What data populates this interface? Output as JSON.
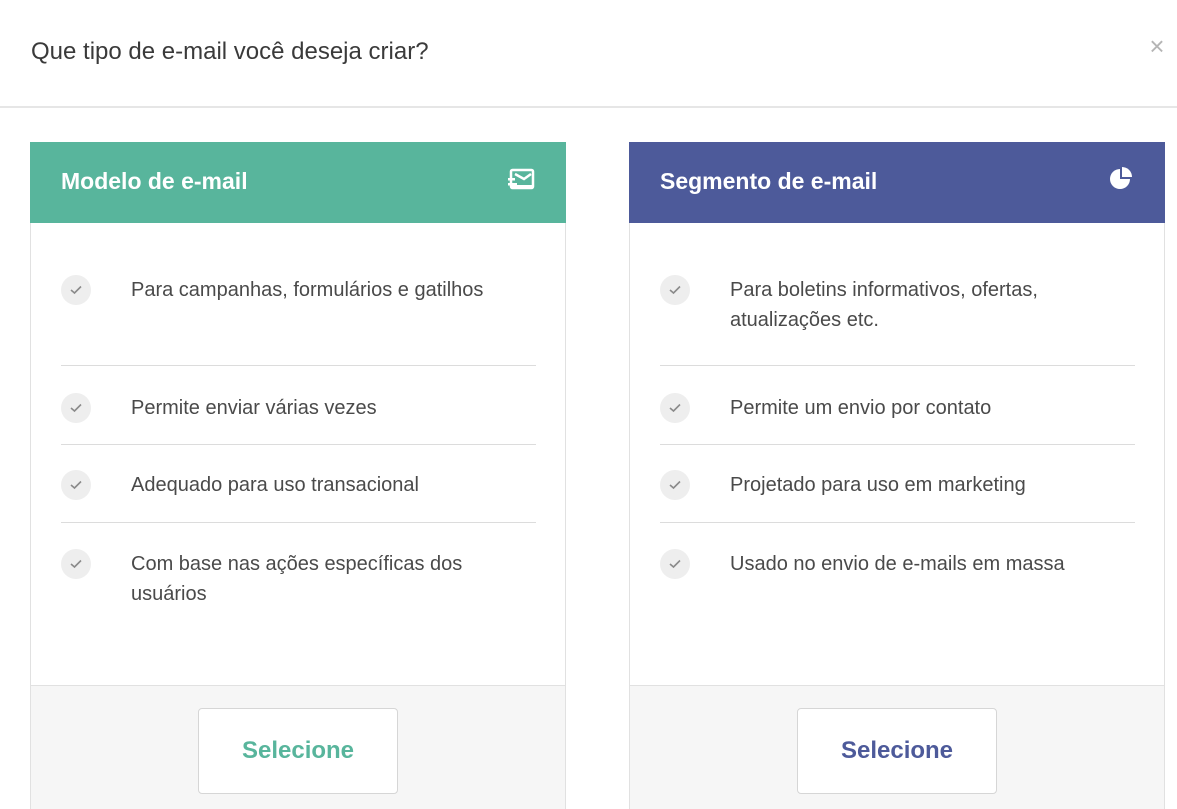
{
  "dialog": {
    "title": "Que tipo de e-mail você deseja criar?",
    "close_symbol": "×"
  },
  "cards": [
    {
      "title": "Modelo de e-mail",
      "icon": "mail-template-icon",
      "color": "#58b59c",
      "features": [
        "Para campanhas, formulários e gatilhos",
        "Permite enviar várias vezes",
        "Adequado para uso transacional",
        "Com base nas ações específicas dos usuários"
      ],
      "button_label": "Selecione"
    },
    {
      "title": "Segmento de e-mail",
      "icon": "pie-chart-icon",
      "color": "#4d5a9a",
      "features": [
        "Para boletins informativos, ofertas, atualizações etc.",
        "Permite um envio por contato",
        "Projetado para uso em marketing",
        "Usado no envio de e-mails em massa"
      ],
      "button_label": "Selecione"
    }
  ],
  "colors": {
    "check_bg": "#eeeeee",
    "divider": "#dcdcdc"
  }
}
